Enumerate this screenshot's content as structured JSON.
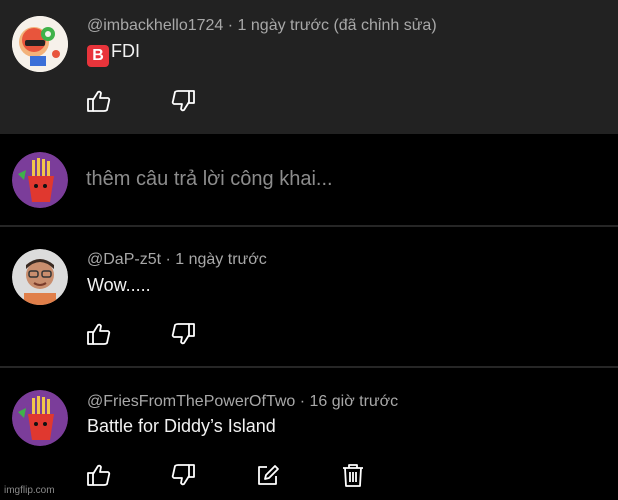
{
  "comments": [
    {
      "author": "@imbackhello1724",
      "meta_sep": " · ",
      "time": "1 ngày trước (đã chỉnh sửa)",
      "badge": "B",
      "text": "FDI"
    },
    {
      "author": "@DaP-z5t",
      "meta_sep": " · ",
      "time": "1 ngày trước",
      "text": "Wow....."
    },
    {
      "author": "@FriesFromThePowerOfTwo",
      "meta_sep": " · ",
      "time": "16 giờ trước",
      "text": "Battle for Diddy’s Island"
    }
  ],
  "reply_box": {
    "placeholder": "thêm câu trả lời công khai..."
  },
  "icons": {
    "like": "thumbs-up-icon",
    "dislike": "thumbs-down-icon",
    "edit": "edit-icon",
    "delete": "trash-icon"
  },
  "colors": {
    "background": "#000000",
    "highlight_bg": "#222222",
    "meta_text": "#a8a8a8",
    "body_text": "#f2f2f2",
    "placeholder_text": "#8c8c8c",
    "badge_red": "#e8343b"
  },
  "watermark": "imgflip.com"
}
